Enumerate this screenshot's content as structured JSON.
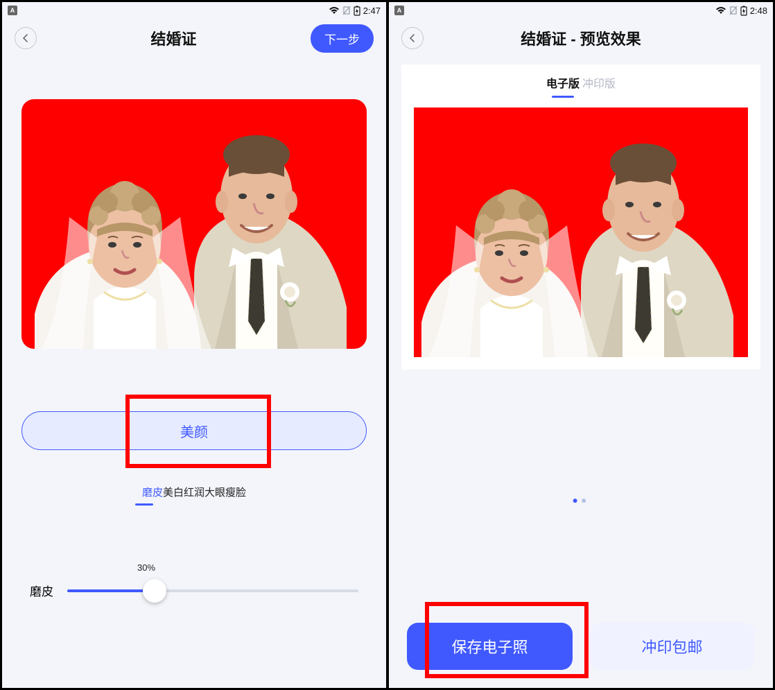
{
  "left": {
    "status": {
      "badge": "A",
      "time": "2:47"
    },
    "nav": {
      "title": "结婚证",
      "next": "下一步"
    },
    "beauty_button": "美颜",
    "filters": {
      "items": [
        "磨皮",
        "美白",
        "红润",
        "大眼",
        "瘦脸"
      ],
      "active_index": 0
    },
    "slider": {
      "label": "磨皮",
      "percent_text": "30%",
      "percent": 30
    }
  },
  "right": {
    "status": {
      "badge": "A",
      "time": "2:48"
    },
    "nav": {
      "title": "结婚证 - 预览效果"
    },
    "tabs": {
      "items": [
        "电子版",
        "冲印版"
      ],
      "active_index": 0
    },
    "buttons": {
      "save": "保存电子照",
      "print": "冲印包邮"
    }
  },
  "photo_bg": "#ff0000"
}
